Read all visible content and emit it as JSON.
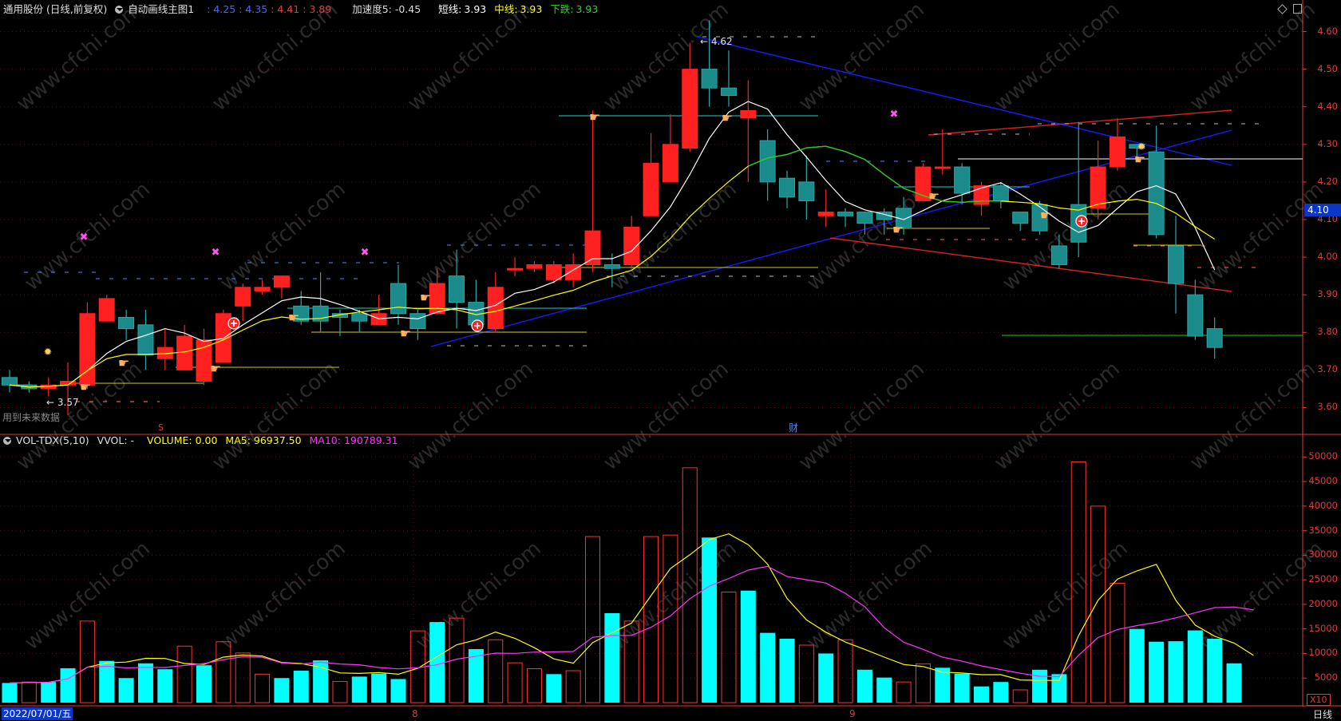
{
  "header": {
    "stock": "通用股份 (日线,前复权)",
    "indicator_name": "自动画线主图1",
    "v1": ": 4.25",
    "v2": ": 4.35",
    "v3": ": 4.41",
    "v4": ": 3.89",
    "accel": "加速度5: -0.45",
    "short_label": "短线:",
    "short_val": "3.93",
    "mid_label": "中线:",
    "mid_val": "3.93",
    "down_label": "下跌:",
    "down_val": "3.93"
  },
  "price_axis": [
    "4.60",
    "4.50",
    "4.40",
    "4.30",
    "4.20",
    "4.10",
    "4.00",
    "3.90",
    "3.80",
    "3.70",
    "3.60"
  ],
  "price_marker": "4.10",
  "annotations": {
    "high": "4.62",
    "low": "3.57",
    "no_future": "用到未来数据",
    "cai": "财",
    "s_mark": "S"
  },
  "vol_header": {
    "name": "VOL-TDX(5,10)",
    "vvol": "VVOL: -",
    "volume": "VOLUME: 0.00",
    "ma5": "MA5: 96937.50",
    "ma10": "MA10: 190789.31"
  },
  "vol_axis": [
    "50000",
    "45000",
    "40000",
    "35000",
    "30000",
    "25000",
    "20000",
    "15000",
    "10000",
    "5000"
  ],
  "vol_unit": "X10",
  "bottom": {
    "date": "2022/07/01/五",
    "m8": "8",
    "m9": "9",
    "period": "日线"
  },
  "watermark": "www.cfchi.com",
  "colors": {
    "up": "#ff2020",
    "down": "#1a8a8a",
    "vol_down": "#00ffff",
    "ma_short": "#ffffff",
    "ma_mid": "#ffff00",
    "ma10_vol": "#ff33ff",
    "axis": "#e23a3a"
  },
  "chart_data": {
    "type": "candlestick",
    "candles": [
      [
        3.68,
        3.66,
        3.7,
        3.64
      ],
      [
        3.66,
        3.65,
        3.67,
        3.64
      ],
      [
        3.65,
        3.66,
        3.68,
        3.63
      ],
      [
        3.66,
        3.67,
        3.72,
        3.58
      ],
      [
        3.66,
        3.85,
        3.88,
        3.65
      ],
      [
        3.83,
        3.89,
        3.9,
        3.83
      ],
      [
        3.84,
        3.81,
        3.86,
        3.78
      ],
      [
        3.82,
        3.74,
        3.86,
        3.7
      ],
      [
        3.73,
        3.76,
        3.81,
        3.7
      ],
      [
        3.7,
        3.79,
        3.82,
        3.7
      ],
      [
        3.67,
        3.78,
        3.81,
        3.66
      ],
      [
        3.72,
        3.85,
        3.86,
        3.72
      ],
      [
        3.87,
        3.92,
        3.93,
        3.83
      ],
      [
        3.91,
        3.92,
        3.94,
        3.9
      ],
      [
        3.92,
        3.95,
        3.95,
        3.89
      ],
      [
        3.87,
        3.83,
        3.91,
        3.82
      ],
      [
        3.87,
        3.83,
        3.96,
        3.8
      ],
      [
        3.85,
        3.84,
        3.86,
        3.79
      ],
      [
        3.85,
        3.83,
        3.86,
        3.8
      ],
      [
        3.82,
        3.85,
        3.9,
        3.82
      ],
      [
        3.93,
        3.85,
        3.98,
        3.82
      ],
      [
        3.85,
        3.81,
        3.86,
        3.78
      ],
      [
        3.85,
        3.93,
        3.97,
        3.85
      ],
      [
        3.95,
        3.88,
        4.02,
        3.81
      ],
      [
        3.88,
        3.82,
        3.94,
        3.8
      ],
      [
        3.81,
        3.92,
        3.96,
        3.8
      ],
      [
        3.97,
        3.97,
        4.0,
        3.95
      ],
      [
        3.97,
        3.98,
        3.99,
        3.96
      ],
      [
        3.94,
        3.98,
        3.99,
        3.93
      ],
      [
        3.94,
        3.98,
        4.01,
        3.92
      ],
      [
        3.98,
        4.07,
        4.39,
        3.96
      ],
      [
        3.98,
        3.97,
        4.01,
        3.92
      ],
      [
        3.98,
        4.08,
        4.11,
        3.97
      ],
      [
        4.11,
        4.25,
        4.33,
        4.11
      ],
      [
        4.2,
        4.3,
        4.38,
        4.2
      ],
      [
        4.29,
        4.5,
        4.57,
        4.28
      ],
      [
        4.5,
        4.45,
        4.63,
        4.4
      ],
      [
        4.45,
        4.43,
        4.55,
        4.4
      ],
      [
        4.37,
        4.39,
        4.47,
        4.2
      ],
      [
        4.31,
        4.2,
        4.34,
        4.15
      ],
      [
        4.21,
        4.16,
        4.23,
        4.13
      ],
      [
        4.2,
        4.15,
        4.27,
        4.1
      ],
      [
        4.11,
        4.12,
        4.18,
        4.08
      ],
      [
        4.12,
        4.11,
        4.13,
        4.08
      ],
      [
        4.12,
        4.09,
        4.12,
        4.06
      ],
      [
        4.12,
        4.1,
        4.13,
        4.06
      ],
      [
        4.13,
        4.08,
        4.16,
        4.06
      ],
      [
        4.15,
        4.24,
        4.25,
        4.15
      ],
      [
        4.24,
        4.24,
        4.34,
        4.22
      ],
      [
        4.24,
        4.17,
        4.25,
        4.14
      ],
      [
        4.14,
        4.19,
        4.2,
        4.11
      ],
      [
        4.19,
        4.15,
        4.2,
        4.13
      ],
      [
        4.12,
        4.09,
        4.12,
        4.07
      ],
      [
        4.14,
        4.07,
        4.15,
        4.06
      ],
      [
        4.03,
        3.98,
        4.06,
        3.97
      ],
      [
        4.14,
        4.04,
        4.36,
        4.0
      ],
      [
        4.13,
        4.24,
        4.31,
        4.1
      ],
      [
        4.24,
        4.32,
        4.37,
        4.23
      ],
      [
        4.3,
        4.29,
        4.3,
        4.26
      ],
      [
        4.28,
        4.06,
        4.35,
        4.05
      ],
      [
        4.03,
        3.93,
        4.11,
        3.85
      ],
      [
        3.9,
        3.79,
        3.94,
        3.78
      ],
      [
        3.81,
        3.76,
        3.84,
        3.73
      ]
    ],
    "volume": [
      [
        4000,
        0
      ],
      [
        4200,
        1
      ],
      [
        4200,
        0
      ],
      [
        7000,
        0
      ],
      [
        16600,
        1
      ],
      [
        8500,
        0
      ],
      [
        5000,
        0
      ],
      [
        8000,
        0
      ],
      [
        6800,
        0
      ],
      [
        11500,
        1
      ],
      [
        7600,
        0
      ],
      [
        12400,
        1
      ],
      [
        10100,
        1
      ],
      [
        5800,
        1
      ],
      [
        5000,
        0
      ],
      [
        6500,
        0
      ],
      [
        8600,
        0
      ],
      [
        4300,
        1
      ],
      [
        5300,
        0
      ],
      [
        5900,
        0
      ],
      [
        4800,
        0
      ],
      [
        14600,
        1
      ],
      [
        16400,
        0
      ],
      [
        17200,
        1
      ],
      [
        10900,
        0
      ],
      [
        12800,
        1
      ],
      [
        8100,
        1
      ],
      [
        6900,
        1
      ],
      [
        5800,
        0
      ],
      [
        6500,
        1
      ],
      [
        33800,
        1
      ],
      [
        18200,
        0
      ],
      [
        16600,
        1
      ],
      [
        33800,
        1
      ],
      [
        34100,
        1
      ],
      [
        47800,
        1
      ],
      [
        33600,
        0
      ],
      [
        22500,
        1
      ],
      [
        22800,
        0
      ],
      [
        14200,
        0
      ],
      [
        13000,
        0
      ],
      [
        11700,
        1
      ],
      [
        10000,
        0
      ],
      [
        12800,
        1
      ],
      [
        6700,
        0
      ],
      [
        5100,
        0
      ],
      [
        4200,
        1
      ],
      [
        7900,
        1
      ],
      [
        7100,
        0
      ],
      [
        5900,
        0
      ],
      [
        3300,
        0
      ],
      [
        4200,
        0
      ],
      [
        2600,
        1
      ],
      [
        6700,
        0
      ],
      [
        5800,
        0
      ],
      [
        49000,
        1
      ],
      [
        40000,
        1
      ],
      [
        24300,
        1
      ],
      [
        15000,
        0
      ],
      [
        12400,
        0
      ],
      [
        12500,
        0
      ],
      [
        14700,
        0
      ],
      [
        13000,
        0
      ],
      [
        8000,
        0
      ],
      [
        0,
        1
      ]
    ],
    "ylim": [
      3.55,
      4.65
    ],
    "vol_ylim": [
      0,
      52000
    ]
  }
}
